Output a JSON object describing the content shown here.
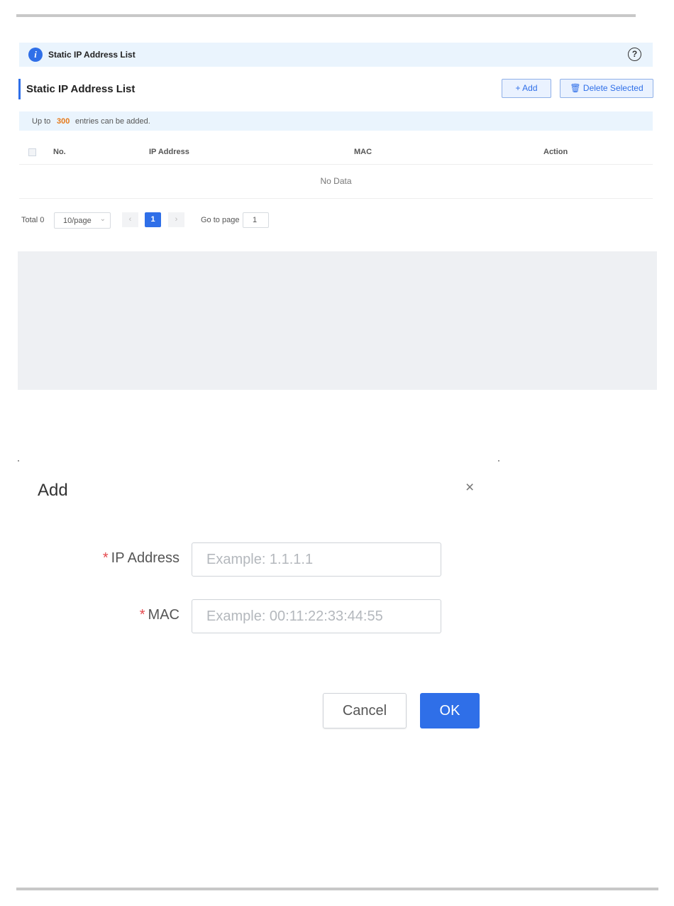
{
  "banner": {
    "title": "Static IP Address List",
    "help_glyph": "?"
  },
  "section": {
    "title": "Static IP Address List",
    "add_label": "+ Add",
    "delete_label": "🗑 Delete Selected"
  },
  "hint": {
    "prefix": "Up to",
    "count": "300",
    "suffix": "entries can be added."
  },
  "table": {
    "columns": [
      "No.",
      "IP Address",
      "MAC",
      "Action"
    ],
    "empty_text": "No Data"
  },
  "pagination": {
    "total": "Total 0",
    "page_size": "10/page",
    "prev": "‹",
    "current_page": "1",
    "next": "›",
    "goto_label": "Go to page",
    "goto_value": "1"
  },
  "dialog": {
    "title": "Add",
    "close_glyph": "×",
    "fields": [
      {
        "required": "*",
        "label": "IP Address",
        "placeholder": "Example: 1.1.1.1"
      },
      {
        "required": "*",
        "label": "MAC",
        "placeholder": "Example: 00:11:22:33:44:55"
      }
    ],
    "cancel_label": "Cancel",
    "ok_label": "OK"
  },
  "colors": {
    "accent": "#2f6fe8",
    "banner_bg": "#eaf4fd",
    "warning_number": "#e6791a",
    "required": "#e5484d"
  },
  "icons": {
    "info": "info-icon",
    "help": "help-icon",
    "delete": "trash-icon",
    "close": "close-icon"
  }
}
